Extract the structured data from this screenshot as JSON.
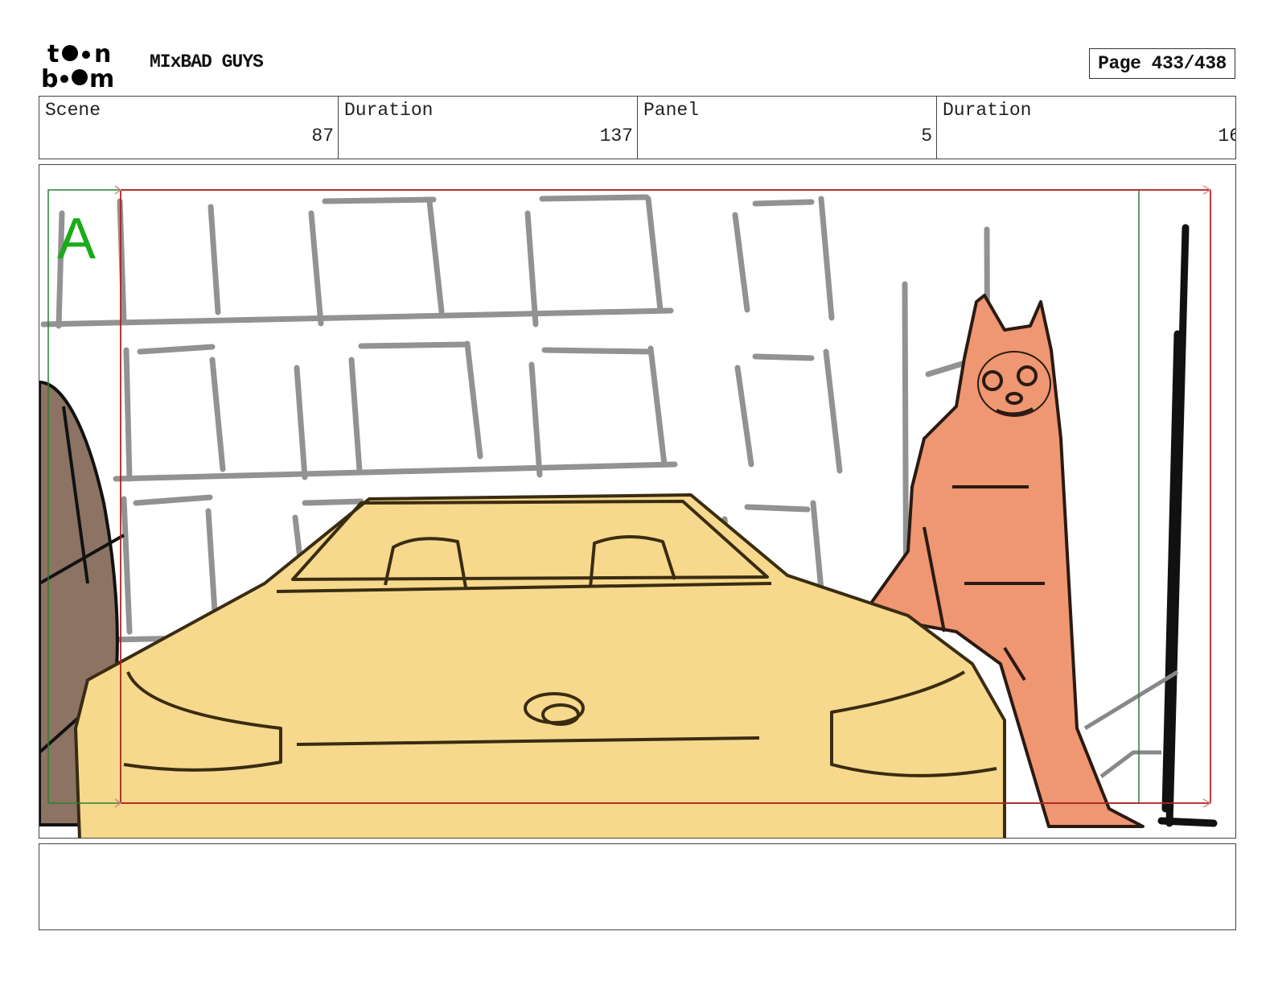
{
  "header": {
    "logo_text": "toon boom",
    "project_title": "MIxBAD GUYS",
    "page_label": "Page 433/438"
  },
  "info": {
    "scene_label": "Scene",
    "scene_value": "87",
    "scene_duration_label": "Duration",
    "scene_duration_value": "137",
    "panel_label": "Panel",
    "panel_value": "5",
    "panel_duration_label": "Duration",
    "panel_duration_value": "16"
  },
  "panel": {
    "camera_label": "A",
    "colors": {
      "car": "#f6d98c",
      "character": "#ef9672",
      "figure_left": "#8c7363",
      "camera_frame": "#b22222",
      "safe_frame": "#2e7d32",
      "label_green": "#1aab1a"
    }
  },
  "dialogue": {
    "text": ""
  }
}
